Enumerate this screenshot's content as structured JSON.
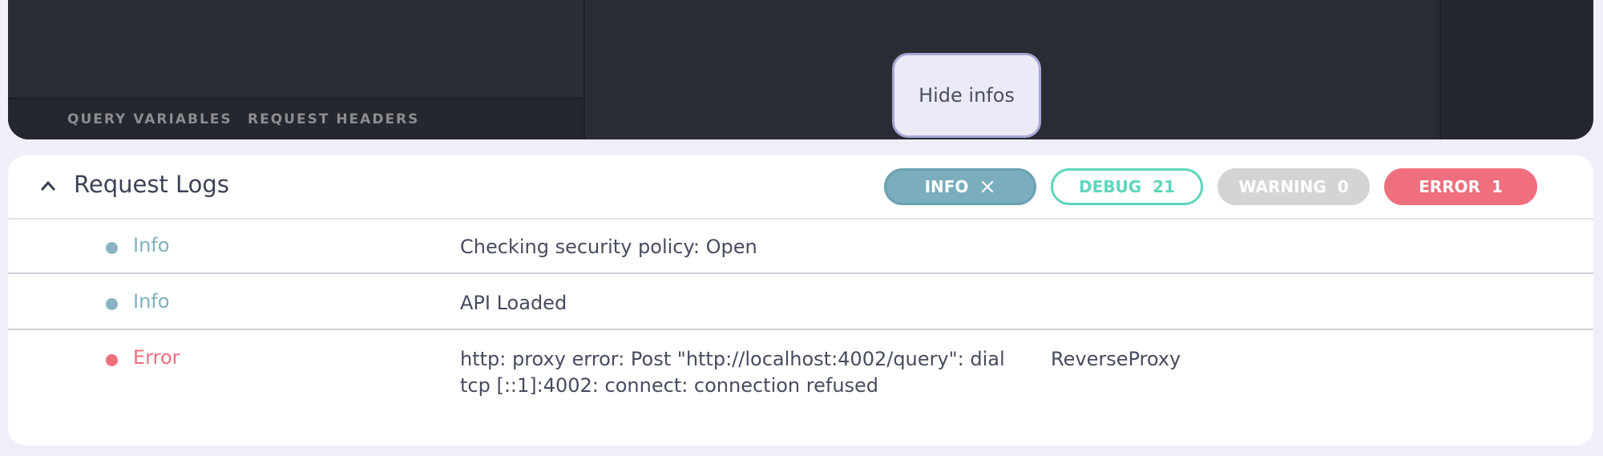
{
  "editor": {
    "bottom_tabs": [
      "QUERY VARIABLES",
      "REQUEST HEADERS"
    ],
    "hide_infos_label": "Hide infos"
  },
  "logs": {
    "title": "Request Logs",
    "filters": {
      "info": {
        "label": "INFO",
        "active": true,
        "icon": "close-icon"
      },
      "debug": {
        "label": "DEBUG",
        "count": "21",
        "color": "#5fd6bc"
      },
      "warning": {
        "label": "WARNING",
        "count": "0",
        "color": "#d4d4d7"
      },
      "error": {
        "label": "ERROR",
        "count": "1",
        "color": "#ef6f7e"
      }
    },
    "rows": [
      {
        "level": "Info",
        "message": "Checking security policy: Open",
        "source": ""
      },
      {
        "level": "Info",
        "message": "API Loaded",
        "source": ""
      },
      {
        "level": "Error",
        "message": "http: proxy error: Post \"http://localhost:4002/query\": dial tcp [::1]:4002: connect: connection refused",
        "source": "ReverseProxy"
      }
    ]
  },
  "colors": {
    "info": "#7fb0be",
    "error": "#ef6f7e",
    "editor_bg": "#292c33",
    "page_bg": "#efeff8"
  }
}
